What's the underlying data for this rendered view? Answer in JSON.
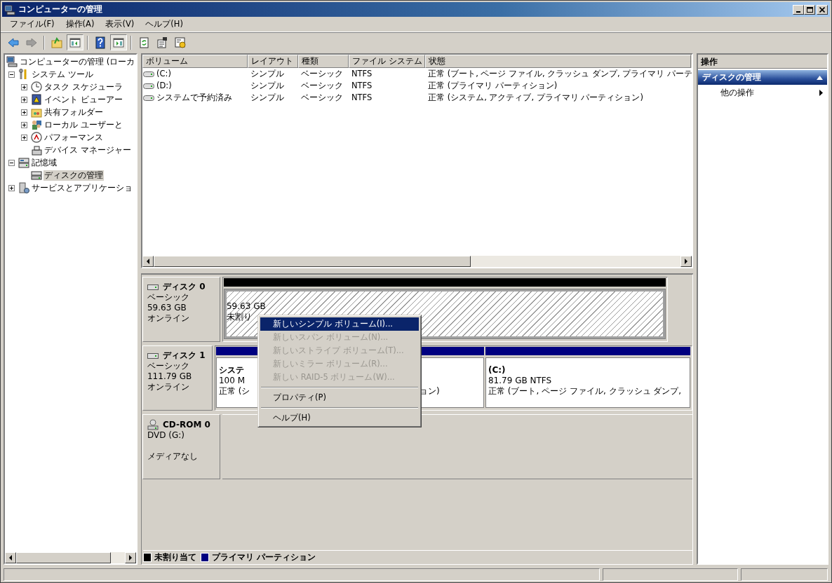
{
  "window": {
    "title": "コンピューターの管理"
  },
  "menu": [
    {
      "label": "ファイル(F)"
    },
    {
      "label": "操作(A)"
    },
    {
      "label": "表示(V)"
    },
    {
      "label": "ヘルプ(H)"
    }
  ],
  "toolbar": [
    {
      "kind": "back",
      "disabled": false,
      "pressed": false
    },
    {
      "kind": "forward",
      "disabled": true,
      "pressed": false
    },
    {
      "kind": "separator"
    },
    {
      "kind": "up",
      "disabled": false,
      "pressed": false
    },
    {
      "kind": "tree",
      "disabled": false,
      "pressed": true
    },
    {
      "kind": "separator"
    },
    {
      "kind": "help",
      "disabled": false,
      "pressed": false
    },
    {
      "kind": "pane",
      "disabled": false,
      "pressed": true
    },
    {
      "kind": "separator"
    },
    {
      "kind": "refresh",
      "disabled": false,
      "pressed": false
    },
    {
      "kind": "properties",
      "disabled": false,
      "pressed": false
    },
    {
      "kind": "settings",
      "disabled": false,
      "pressed": false
    }
  ],
  "tree": [
    {
      "label": "コンピューターの管理 (ローカ",
      "kind": "computer",
      "selected": false,
      "children": [
        {
          "label": "システム ツール",
          "kind": "tools",
          "expanded": true,
          "selected": false,
          "children": [
            {
              "label": "タスク スケジューラ",
              "kind": "clock",
              "expanded": false,
              "selected": false
            },
            {
              "label": "イベント ビューアー",
              "kind": "event",
              "expanded": false,
              "selected": false
            },
            {
              "label": "共有フォルダー",
              "kind": "folder",
              "expanded": false,
              "selected": false
            },
            {
              "label": "ローカル ユーザーと",
              "kind": "users",
              "expanded": false,
              "selected": false
            },
            {
              "label": "パフォーマンス",
              "kind": "performance",
              "expanded": false,
              "selected": false
            },
            {
              "label": "デバイス マネージャー",
              "kind": "device",
              "selected": false
            }
          ]
        },
        {
          "label": "記憶域",
          "kind": "storage",
          "expanded": true,
          "selected": false,
          "children": [
            {
              "label": "ディスクの管理",
              "kind": "disk",
              "selected": true
            }
          ]
        },
        {
          "label": "サービスとアプリケーショ",
          "kind": "services",
          "expanded": false,
          "selected": false
        }
      ]
    }
  ],
  "volumes": {
    "columns": [
      "ボリューム",
      "レイアウト",
      "種類",
      "ファイル システム",
      "状態"
    ],
    "rows": [
      [
        "(C:)",
        "シンプル",
        "ベーシック",
        "NTFS",
        "正常 (ブート, ページ ファイル, クラッシュ ダンプ, プライマリ パーテ"
      ],
      [
        "(D:)",
        "シンプル",
        "ベーシック",
        "NTFS",
        "正常 (プライマリ パーティション)"
      ],
      [
        "システムで予約済み",
        "シンプル",
        "ベーシック",
        "NTFS",
        "正常 (システム, アクティブ, プライマリ パーティション)"
      ]
    ]
  },
  "disks": [
    {
      "kind": "disk",
      "name": "ディスク 0",
      "lines": [
        "ベーシック",
        "59.63 GB",
        "オンライン"
      ],
      "partitions": [
        {
          "kind": "unallocated",
          "color": "#000000",
          "selected": true,
          "size": "59.63 GB",
          "status": "未割り"
        }
      ]
    },
    {
      "kind": "disk",
      "name": "ディスク 1",
      "lines": [
        "ベーシック",
        "111.79 GB",
        "オンライン"
      ],
      "partitions": [
        {
          "kind": "primary",
          "color": "#000080",
          "selected": false,
          "name": "システ",
          "size": "100 M",
          "status": "正常 (シ"
        },
        {
          "kind": "primary",
          "color": "#000080",
          "selected": false,
          "status": "ョン)"
        },
        {
          "kind": "primary",
          "color": "#000080",
          "selected": false,
          "name": "(C:)",
          "size": "81.79 GB NTFS",
          "status": "正常 (ブート, ページ ファイル, クラッシュ ダンプ,"
        }
      ]
    },
    {
      "kind": "cdrom",
      "name": "CD-ROM 0",
      "lines": [
        "DVD (G:)"
      ],
      "note": "メディアなし"
    }
  ],
  "legend": [
    {
      "label": "未割り当て",
      "color": "#000000"
    },
    {
      "label": "プライマリ パーティション",
      "color": "#000080"
    }
  ],
  "context_menu": [
    {
      "kind": "item",
      "label": "新しいシンプル ボリューム(I)...",
      "disabled": false,
      "selected": true
    },
    {
      "kind": "item",
      "label": "新しいスパン ボリューム(N)...",
      "disabled": true,
      "selected": false
    },
    {
      "kind": "item",
      "label": "新しいストライプ ボリューム(T)...",
      "disabled": true,
      "selected": false
    },
    {
      "kind": "item",
      "label": "新しいミラー ボリューム(R)...",
      "disabled": true,
      "selected": false
    },
    {
      "kind": "item",
      "label": "新しい RAID-5 ボリューム(W)...",
      "disabled": true,
      "selected": false
    },
    {
      "kind": "separator"
    },
    {
      "kind": "item",
      "label": "プロパティ(P)",
      "disabled": false,
      "selected": false
    },
    {
      "kind": "separator"
    },
    {
      "kind": "item",
      "label": "ヘルプ(H)",
      "disabled": false,
      "selected": false
    }
  ],
  "actions": {
    "title": "操作",
    "sections": [
      {
        "label": "ディスクの管理",
        "expanded": true,
        "items": [
          {
            "label": "他の操作",
            "submenu": true
          }
        ]
      }
    ]
  }
}
